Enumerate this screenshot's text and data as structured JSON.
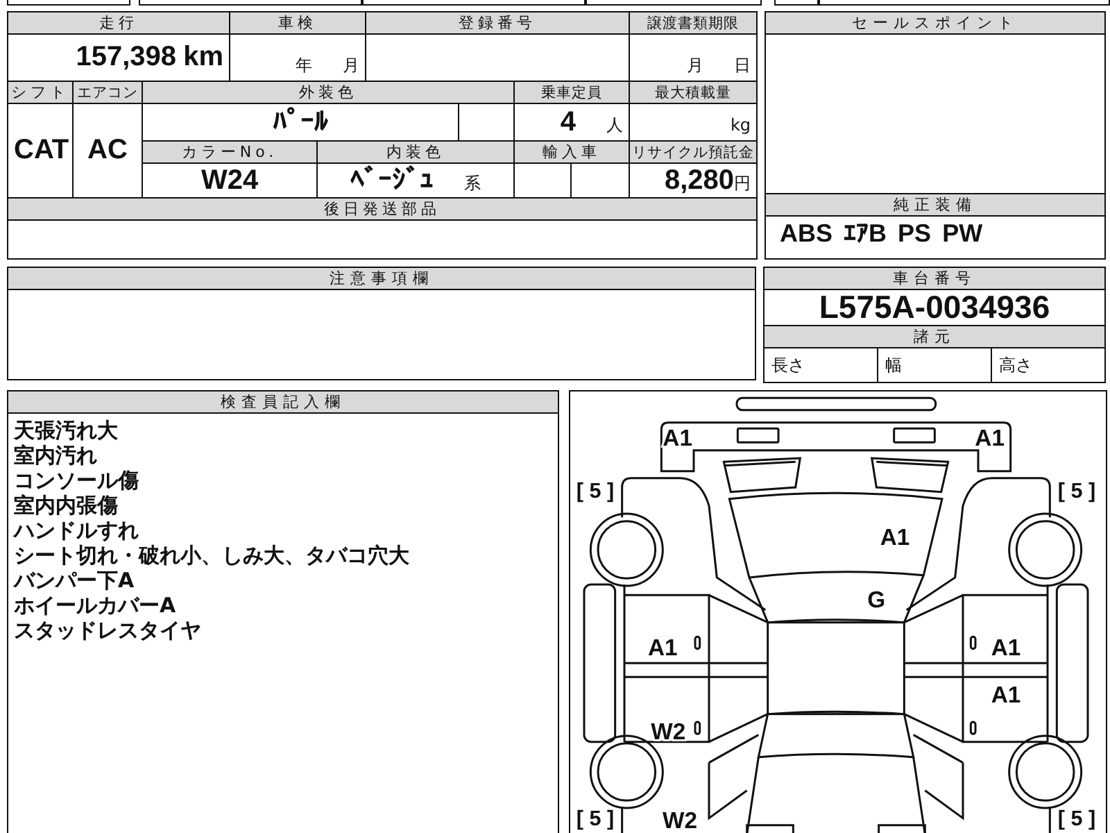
{
  "vehicle": {
    "mileage": {
      "label": "走行",
      "value": "157,398",
      "unit": "km"
    },
    "inspection": {
      "label": "車検",
      "year_unit": "年",
      "month_unit": "月"
    },
    "registration": {
      "label": "登録番号"
    },
    "transfer_deadline": {
      "label": "譲渡書類期限",
      "month_unit": "月",
      "day_unit": "日"
    },
    "shift": {
      "label": "シフト",
      "value": "CAT"
    },
    "aircon": {
      "label": "エアコン",
      "value": "AC"
    },
    "exterior_color": {
      "label": "外装色",
      "value": "ﾊﾟｰﾙ"
    },
    "capacity": {
      "label": "乗車定員",
      "value": "4",
      "unit": "人"
    },
    "max_load": {
      "label": "最大積載量",
      "unit": "kg"
    },
    "color_no": {
      "label": "カラーNo.",
      "value": "W24"
    },
    "interior_color": {
      "label": "内装色",
      "value": "ﾍﾞｰｼﾞｭ",
      "suffix": "系"
    },
    "imported": {
      "label": "輸入車"
    },
    "recycle_fee": {
      "label": "リサイクル預託金",
      "value": "8,280",
      "unit": "円"
    },
    "later_parts": {
      "label": "後日発送部品"
    }
  },
  "caution": {
    "label": "注意事項欄"
  },
  "sales_points": {
    "label": "セールスポイント"
  },
  "equipment": {
    "label": "純正装備",
    "items": [
      "ABS",
      "ｴｱB",
      "PS",
      "PW"
    ]
  },
  "chassis": {
    "label": "車台番号",
    "value": "L575A-0034936"
  },
  "specs": {
    "label": "諸元",
    "items": [
      "長さ",
      "幅",
      "高さ"
    ]
  },
  "inspector_notes": {
    "label": "検査員記入欄",
    "lines": [
      "天張汚れ大",
      "室内汚れ",
      "コンソール傷",
      "室内内張傷",
      "ハンドルすれ",
      "シート切れ・破れ小、しみ大、タバコ穴大",
      "バンパー下A",
      "ホイールカバーA",
      "スタッドレスタイヤ"
    ]
  },
  "diagram": {
    "marks": [
      {
        "code": "A1"
      },
      {
        "code": "A1"
      },
      {
        "code": "A1"
      },
      {
        "code": "G"
      },
      {
        "code": "A1"
      },
      {
        "code": "A1"
      },
      {
        "code": "A1"
      },
      {
        "code": "W2"
      },
      {
        "code": "W2"
      }
    ],
    "tire_readings": [
      "[ 5 ]",
      "[ 5 ]",
      "[ 5 ]",
      "[ 5 ]"
    ]
  }
}
